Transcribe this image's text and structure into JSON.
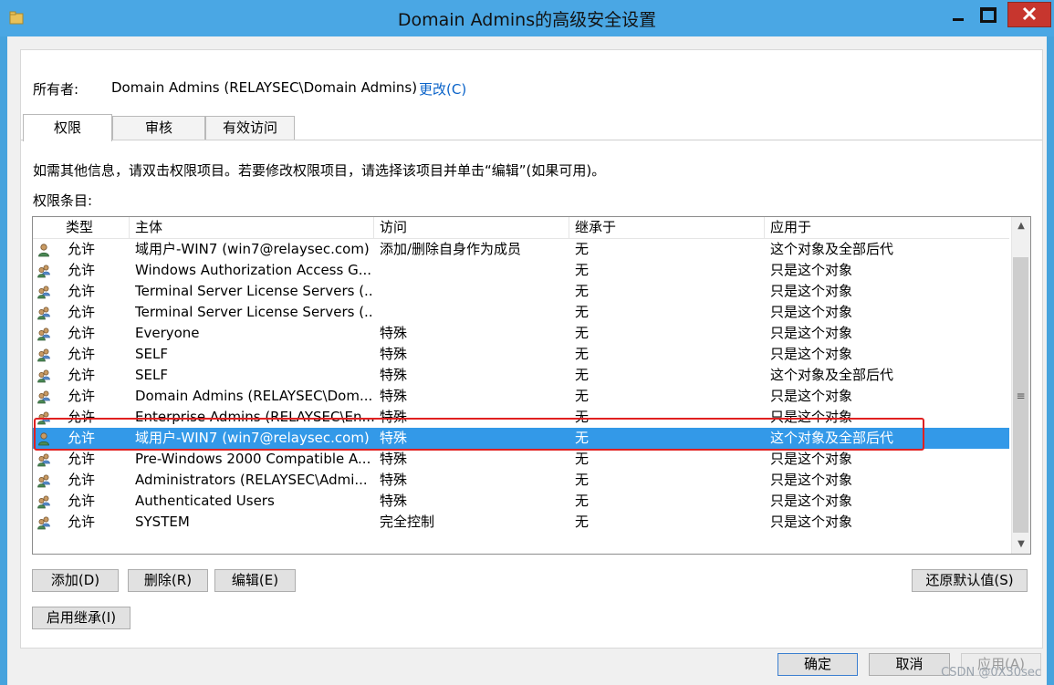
{
  "window": {
    "title": "Domain Admins的高级安全设置"
  },
  "owner": {
    "label": "所有者:",
    "value": "Domain Admins (RELAYSEC\\Domain Admins)",
    "change_link": "更改(C)"
  },
  "tabs": [
    {
      "label": "权限",
      "active": true
    },
    {
      "label": "审核",
      "active": false
    },
    {
      "label": "有效访问",
      "active": false
    }
  ],
  "info_text": "如需其他信息，请双击权限项目。若要修改权限项目，请选择该项目并单击“编辑”(如果可用)。",
  "entries_label": "权限条目:",
  "columns": [
    "类型",
    "主体",
    "访问",
    "继承于",
    "应用于"
  ],
  "rows": [
    {
      "icon": "single-user-icon",
      "type": "允许",
      "principal": "域用户-WIN7 (win7@relaysec.com)",
      "access": "添加/删除自身作为成员",
      "inherited": "无",
      "applies": "这个对象及全部后代",
      "selected": false
    },
    {
      "icon": "group-icon",
      "type": "允许",
      "principal": "Windows Authorization Access G...",
      "access": "",
      "inherited": "无",
      "applies": "只是这个对象",
      "selected": false
    },
    {
      "icon": "group-icon",
      "type": "允许",
      "principal": "Terminal Server License Servers (...",
      "access": "",
      "inherited": "无",
      "applies": "只是这个对象",
      "selected": false
    },
    {
      "icon": "group-icon",
      "type": "允许",
      "principal": "Terminal Server License Servers (...",
      "access": "",
      "inherited": "无",
      "applies": "只是这个对象",
      "selected": false
    },
    {
      "icon": "group-icon",
      "type": "允许",
      "principal": "Everyone",
      "access": "特殊",
      "inherited": "无",
      "applies": "只是这个对象",
      "selected": false
    },
    {
      "icon": "group-icon",
      "type": "允许",
      "principal": "SELF",
      "access": "特殊",
      "inherited": "无",
      "applies": "只是这个对象",
      "selected": false
    },
    {
      "icon": "group-icon",
      "type": "允许",
      "principal": "SELF",
      "access": "特殊",
      "inherited": "无",
      "applies": "这个对象及全部后代",
      "selected": false
    },
    {
      "icon": "group-icon",
      "type": "允许",
      "principal": "Domain Admins (RELAYSEC\\Dom...",
      "access": "特殊",
      "inherited": "无",
      "applies": "只是这个对象",
      "selected": false
    },
    {
      "icon": "group-icon",
      "type": "允许",
      "principal": "Enterprise Admins (RELAYSEC\\En...",
      "access": "特殊",
      "inherited": "无",
      "applies": "只是这个对象",
      "selected": false
    },
    {
      "icon": "single-user-icon",
      "type": "允许",
      "principal": "域用户-WIN7 (win7@relaysec.com)",
      "access": "特殊",
      "inherited": "无",
      "applies": "这个对象及全部后代",
      "selected": true
    },
    {
      "icon": "group-icon",
      "type": "允许",
      "principal": "Pre-Windows 2000 Compatible A...",
      "access": "特殊",
      "inherited": "无",
      "applies": "只是这个对象",
      "selected": false
    },
    {
      "icon": "group-icon",
      "type": "允许",
      "principal": "Administrators (RELAYSEC\\Admi...",
      "access": "特殊",
      "inherited": "无",
      "applies": "只是这个对象",
      "selected": false
    },
    {
      "icon": "group-icon",
      "type": "允许",
      "principal": "Authenticated Users",
      "access": "特殊",
      "inherited": "无",
      "applies": "只是这个对象",
      "selected": false
    },
    {
      "icon": "group-icon",
      "type": "允许",
      "principal": "SYSTEM",
      "access": "完全控制",
      "inherited": "无",
      "applies": "只是这个对象",
      "selected": false
    }
  ],
  "buttons": {
    "add": "添加(D)",
    "remove": "删除(R)",
    "edit": "编辑(E)",
    "restore_defaults": "还原默认值(S)",
    "enable_inheritance": "启用继承(I)",
    "ok": "确定",
    "cancel": "取消",
    "apply": "应用(A)"
  },
  "watermark": "CSDN @0X30sec"
}
